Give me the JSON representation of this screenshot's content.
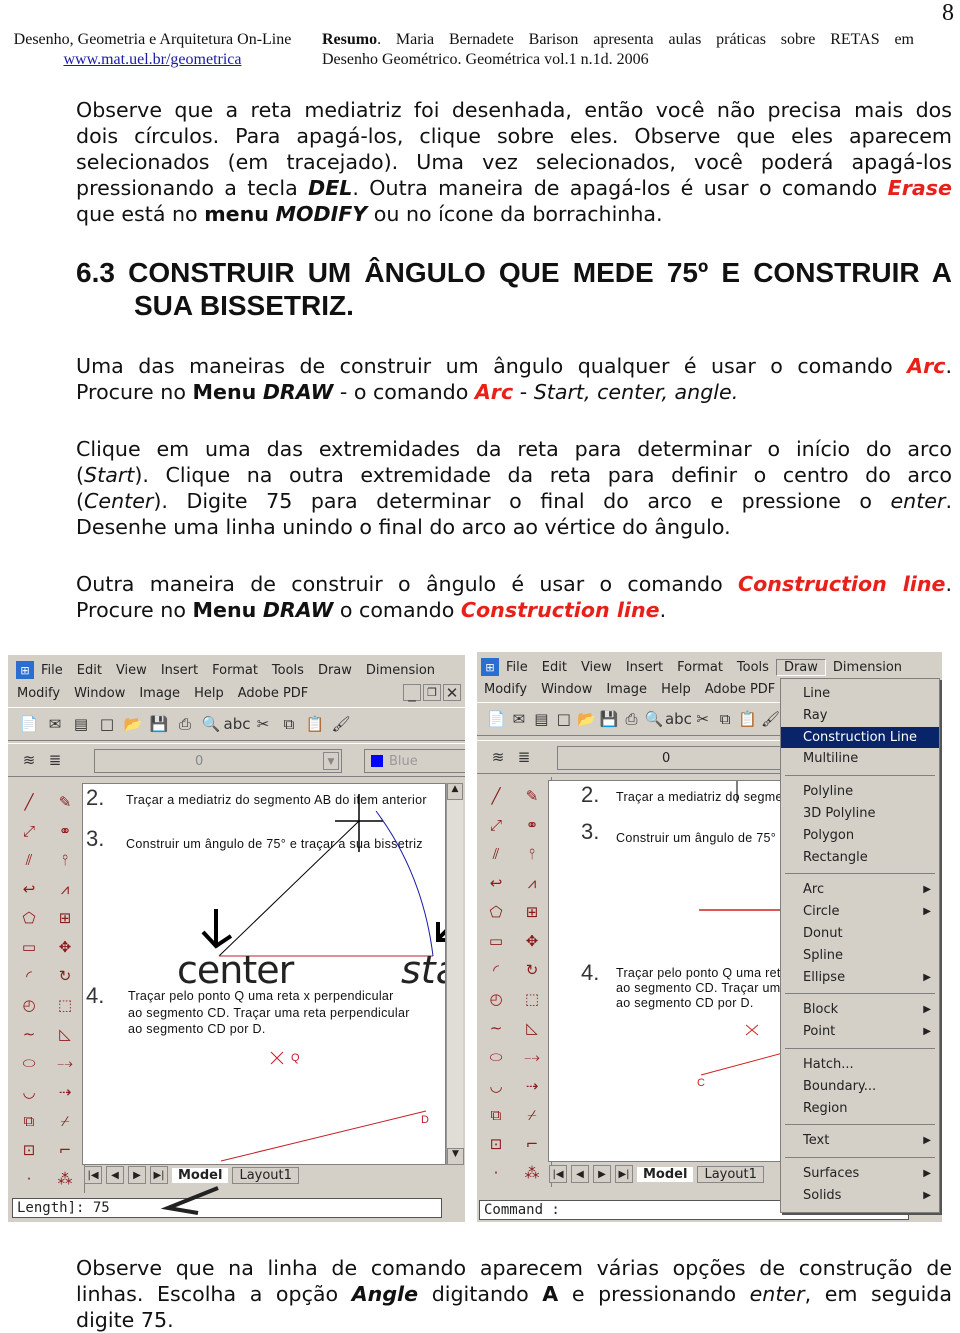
{
  "header": {
    "page_number": "8",
    "left_title": "Desenho, Geometria e Arquitetura On-Line",
    "left_link": "www.mat.uel.br/geometrica",
    "right_bold": "Resumo",
    "right_line1": ". Maria Bernadete Barison apresenta aulas práticas sobre RETAS em",
    "right_line2": "Desenho Geométrico. Geométrica vol.1 n.1d. 2006"
  },
  "paragraphs": [
    [
      [
        [
          "Observe que a reta mediatriz foi desenhada, então você não precisa mais dos",
          ""
        ]
      ],
      [
        [
          "dois círculos. Para apagá-los, clique sobre eles. Observe que eles aparecem",
          ""
        ]
      ],
      [
        [
          "selecionados (em tracejado). Uma vez selecionados, você poderá apagá-los",
          ""
        ]
      ],
      [
        [
          "pressionando a tecla ",
          ""
        ],
        [
          "DEL",
          "bi"
        ],
        [
          ". Outra maneira de apagá-los é usar o comando ",
          ""
        ],
        [
          "Erase",
          "r"
        ]
      ],
      [
        [
          "que está no ",
          ""
        ],
        [
          "menu",
          "b"
        ],
        [
          " ",
          ""
        ],
        [
          "MODIFY",
          "bi"
        ],
        [
          " ou no ícone da borrachinha.",
          ""
        ]
      ]
    ],
    [
      [
        [
          "Uma das maneiras de construir um ângulo qualquer é usar o comando ",
          ""
        ],
        [
          "Arc",
          "r"
        ],
        [
          ".",
          ""
        ]
      ],
      [
        [
          "Procure no ",
          ""
        ],
        [
          "Menu",
          "b"
        ],
        [
          " ",
          ""
        ],
        [
          "DRAW",
          "bi"
        ],
        [
          " - o comando ",
          ""
        ],
        [
          "Arc",
          "r"
        ],
        [
          " - ",
          ""
        ],
        [
          "Start, center, angle.",
          "i"
        ]
      ]
    ],
    [
      [
        [
          "Clique em uma das extremidades da reta para determinar o início do arco",
          ""
        ]
      ],
      [
        [
          "(",
          ""
        ],
        [
          "Start",
          "i"
        ],
        [
          "). Clique na outra extremidade da reta para definir o centro do arco",
          ""
        ]
      ],
      [
        [
          "(",
          ""
        ],
        [
          "Center",
          "i"
        ],
        [
          "). Digite 75 para determinar o final do arco e pressione o ",
          ""
        ],
        [
          "enter",
          "i"
        ],
        [
          ".",
          ""
        ]
      ],
      [
        [
          "Desenhe uma linha unindo o final do arco ao vértice do ângulo.",
          ""
        ]
      ]
    ],
    [
      [
        [
          "Outra maneira de construir o ângulo é usar o comando ",
          ""
        ],
        [
          "Construction line",
          "r"
        ],
        [
          ".",
          ""
        ]
      ],
      [
        [
          "Procure no ",
          ""
        ],
        [
          "Menu",
          "b"
        ],
        [
          " ",
          ""
        ],
        [
          "DRAW",
          "bi"
        ],
        [
          " o comando ",
          ""
        ],
        [
          "Construction line",
          "r"
        ],
        [
          ".",
          ""
        ]
      ]
    ],
    [
      [
        [
          "Observe que na linha de comando aparecem várias opções de construção de",
          ""
        ]
      ],
      [
        [
          "linhas. Escolha a opção ",
          ""
        ],
        [
          "Angle",
          "bi"
        ],
        [
          " digitando ",
          ""
        ],
        [
          "A",
          "b"
        ],
        [
          " e pressionando ",
          ""
        ],
        [
          "enter",
          "i"
        ],
        [
          ", em seguida",
          ""
        ]
      ],
      [
        [
          "digite 75.",
          ""
        ]
      ]
    ]
  ],
  "heading": {
    "line1": "6.3 CONSTRUIR UM ÂNGULO QUE MEDE 75º E CONSTRUIR A",
    "line2": "SUA BISSETRIZ."
  },
  "colors": {
    "red": "#e8201a",
    "menu_highlight": "#0a246a",
    "ui_gray": "#d4d0c8"
  },
  "app": {
    "menu_row1": [
      "File",
      "Edit",
      "View",
      "Insert",
      "Format",
      "Tools",
      "Draw",
      "Dimension"
    ],
    "menu_row2": [
      "Modify",
      "Window",
      "Image",
      "Help",
      "Adobe PDF"
    ],
    "toolbar1_icons": [
      "pdf",
      "pdf-mail",
      "pdf-review",
      "new",
      "open",
      "save",
      "print",
      "print-preview",
      "spell-check",
      "cut",
      "copy",
      "paste",
      "match-properties"
    ],
    "toolbar2_icons": [
      "layers",
      "layer-states",
      "light-bulb",
      "sun",
      "freeze",
      "lock",
      "color-swatch"
    ],
    "layer_value": "0",
    "color_value": "Blue",
    "draw_toolbar_icons": [
      "line",
      "construction-line",
      "multiline",
      "polyline",
      "polygon",
      "rectangle",
      "arc",
      "circle",
      "spline",
      "ellipse",
      "ellipse-arc",
      "insert-block",
      "make-block",
      "point"
    ],
    "modify_toolbar_icons": [
      "erase",
      "copy-object",
      "mirror",
      "offset",
      "array",
      "move",
      "rotate",
      "scale",
      "stretch",
      "trim",
      "extend",
      "break",
      "chamfer",
      "explode"
    ],
    "tabs": [
      "Model",
      "Layout1"
    ],
    "drawing": {
      "item2_num": "2.",
      "item2_text": "Traçar a mediatriz do segmento AB do item anterior",
      "item3_num": "3.",
      "item3_text": "Construir um ângulo de 75° e traçar a sua bissetriz",
      "item4_num": "4.",
      "item4_lines": [
        "Traçar pelo ponto Q uma reta x perpendicular",
        "ao segmento CD. Traçar uma reta perpendicular",
        "ao segmento CD por D."
      ],
      "point_q": "Q",
      "point_d": "D",
      "point_c": "C",
      "label_center": "center",
      "label_start": "star"
    },
    "left_command": "Length]: 75",
    "right_command": "Command :",
    "draw_menu": [
      {
        "label": "Line"
      },
      {
        "label": "Ray"
      },
      {
        "label": "Construction Line",
        "highlighted": true
      },
      {
        "label": "Multiline"
      },
      {
        "sep": true
      },
      {
        "label": "Polyline"
      },
      {
        "label": "3D Polyline"
      },
      {
        "label": "Polygon"
      },
      {
        "label": "Rectangle"
      },
      {
        "sep": true
      },
      {
        "label": "Arc",
        "submenu": true
      },
      {
        "label": "Circle",
        "submenu": true
      },
      {
        "label": "Donut"
      },
      {
        "label": "Spline"
      },
      {
        "label": "Ellipse",
        "submenu": true
      },
      {
        "sep": true
      },
      {
        "label": "Block",
        "submenu": true
      },
      {
        "label": "Point",
        "submenu": true
      },
      {
        "sep": true
      },
      {
        "label": "Hatch..."
      },
      {
        "label": "Boundary..."
      },
      {
        "label": "Region"
      },
      {
        "sep": true
      },
      {
        "label": "Text",
        "submenu": true
      },
      {
        "sep": true
      },
      {
        "label": "Surfaces",
        "submenu": true
      },
      {
        "label": "Solids",
        "submenu": true
      }
    ]
  }
}
